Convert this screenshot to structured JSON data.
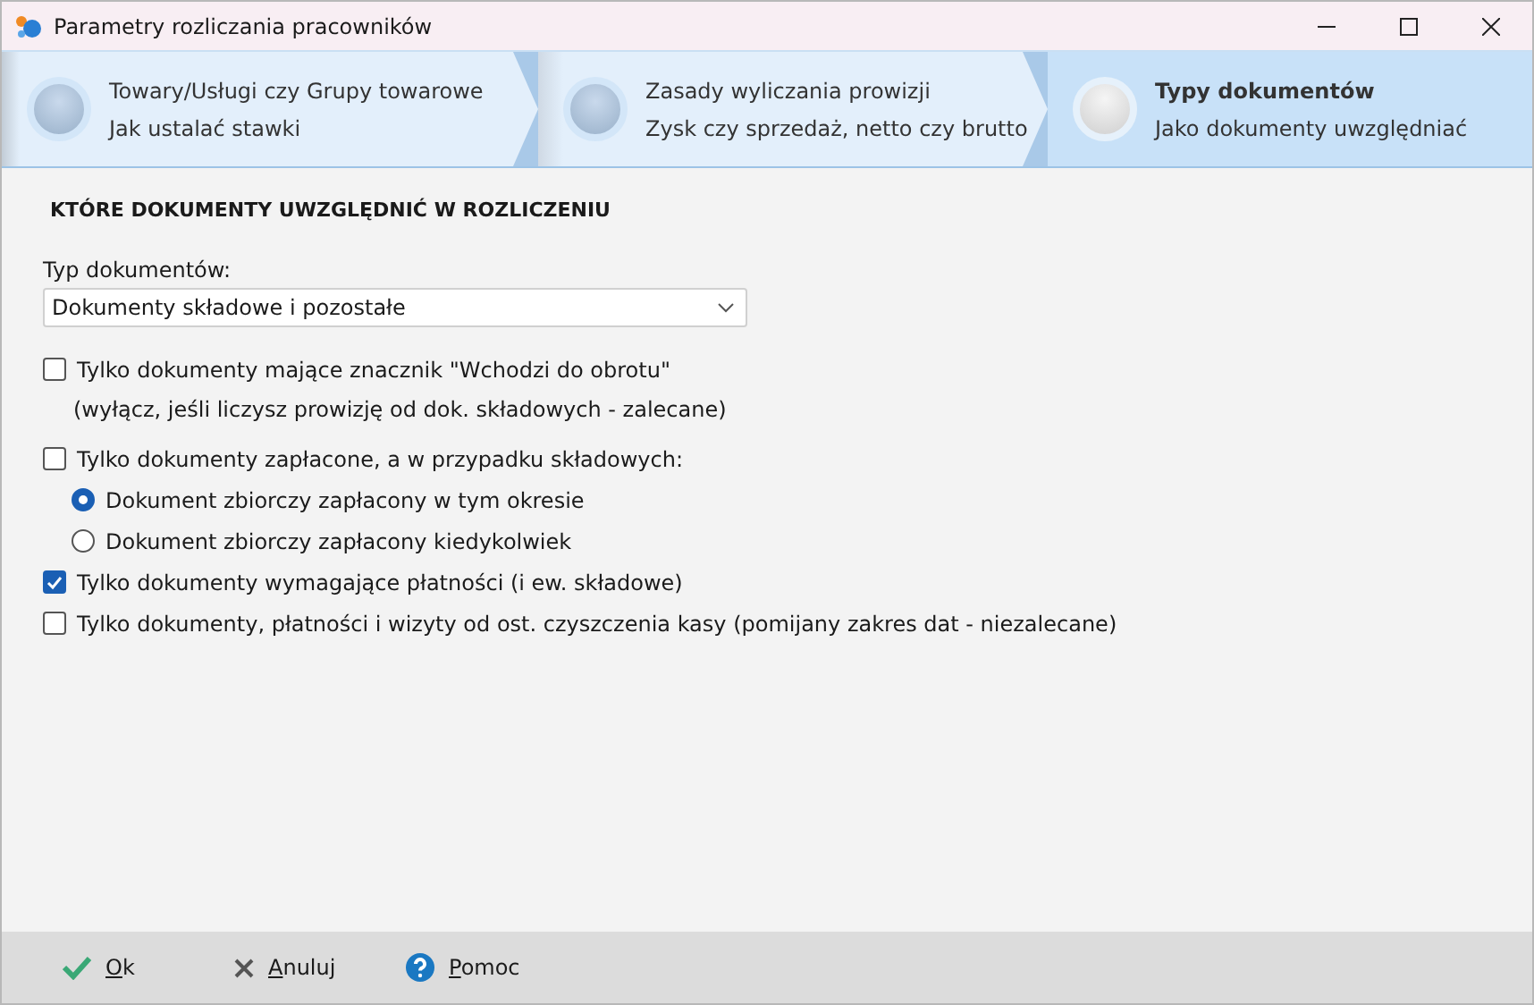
{
  "window": {
    "title": "Parametry rozliczania pracowników"
  },
  "steps": [
    {
      "title": "Towary/Usługi czy Grupy towarowe",
      "subtitle": "Jak ustalać stawki",
      "selected": false
    },
    {
      "title": "Zasady wyliczania prowizji",
      "subtitle": "Zysk czy sprzedaż, netto czy brutto",
      "selected": false
    },
    {
      "title": "Typy dokumentów",
      "subtitle": "Jako dokumenty uwzględniać",
      "selected": true
    }
  ],
  "section_title": "KTÓRE DOKUMENTY UWZGLĘDNIĆ W ROZLICZENIU",
  "document_type": {
    "label": "Typ dokumentów:",
    "value": "Dokumenty składowe i pozostałe"
  },
  "options": [
    {
      "kind": "checkbox",
      "label": "Tylko dokumenty mające znacznik \"Wchodzi do obrotu\"",
      "checked": false
    },
    {
      "kind": "note",
      "label": "(wyłącz, jeśli liczysz prowizję od dok. składowych - zalecane)"
    },
    {
      "kind": "checkbox",
      "label": "Tylko dokumenty zapłacone, a w przypadku składowych:",
      "checked": false
    },
    {
      "kind": "radio",
      "label": "Dokument zbiorczy zapłacony w tym okresie",
      "selected": true
    },
    {
      "kind": "radio",
      "label": "Dokument zbiorczy zapłacony kiedykolwiek",
      "selected": false
    },
    {
      "kind": "checkbox",
      "label": "Tylko dokumenty wymagające płatności (i ew. składowe)",
      "checked": true
    },
    {
      "kind": "checkbox",
      "label": "Tylko dokumenty, płatności i wizyty od ost. czyszczenia kasy (pomijany zakres dat - niezalecane)",
      "checked": false
    }
  ],
  "buttons": [
    {
      "kind": "ok",
      "label": "Ok"
    },
    {
      "kind": "cancel",
      "label": "Anuluj"
    },
    {
      "kind": "help",
      "label": "Pomoc"
    }
  ]
}
